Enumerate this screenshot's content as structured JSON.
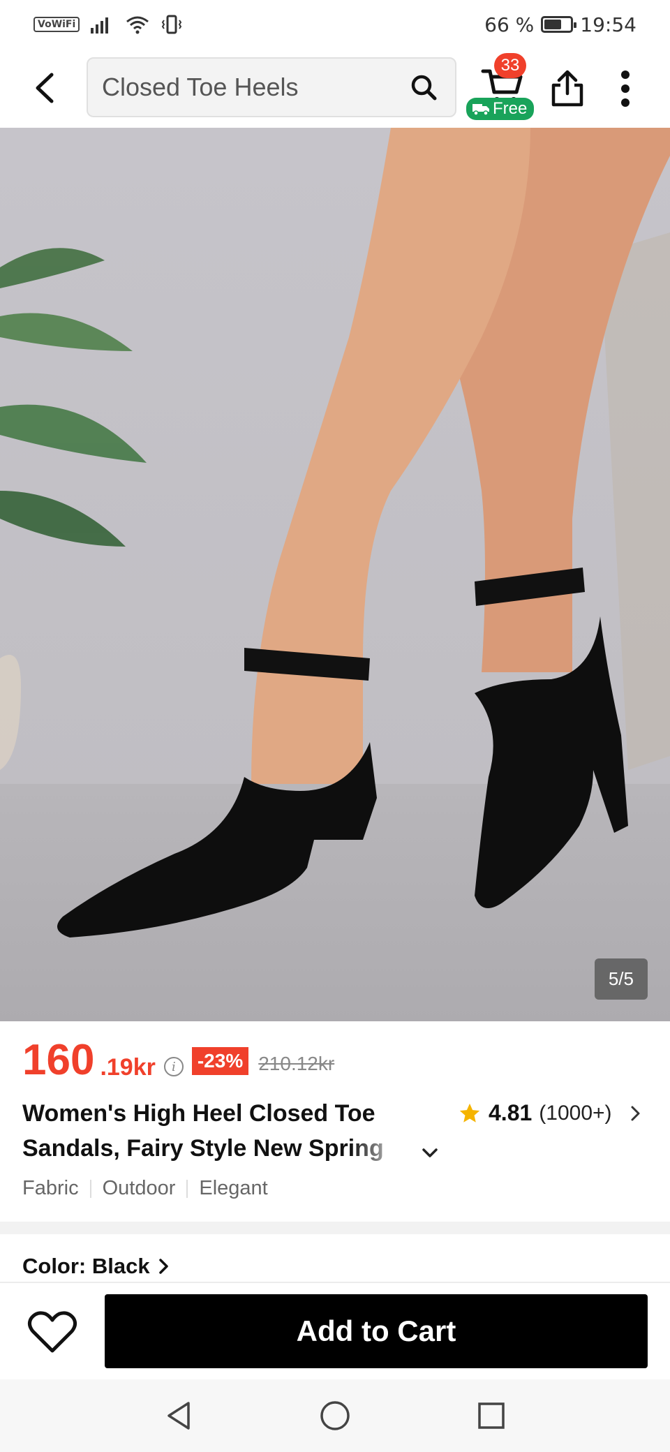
{
  "status_bar": {
    "network_badge": "VoWiFi",
    "battery": "66 %",
    "battery_level": 0.66,
    "time": "19:54"
  },
  "header": {
    "search_value": "Closed Toe Heels",
    "cart_count": "33",
    "free_shipping_label": "Free"
  },
  "gallery": {
    "counter": "5/5"
  },
  "product": {
    "price_integer": "160",
    "price_decimal": ".19kr",
    "discount": "-23%",
    "original_price": "210.12kr",
    "title_line1": "Women's High Heel Closed Toe",
    "title_line2": "Sandals, Fairy Style New Spring",
    "rating_value": "4.81",
    "rating_count": "(1000+)",
    "tags": [
      "Fabric",
      "Outdoor",
      "Elegant"
    ],
    "color_label": "Color: Black"
  },
  "actions": {
    "add_to_cart": "Add to Cart"
  },
  "colors": {
    "accent": "#f0402b",
    "free_green": "#19a35a",
    "star": "#f5b400",
    "button_bg": "#000000"
  },
  "icons": {
    "back": "back-arrow-icon",
    "search": "search-icon",
    "cart": "cart-icon",
    "truck": "truck-icon",
    "share": "share-icon",
    "more": "more-vertical-icon",
    "info": "info-icon",
    "star": "star-icon",
    "chevron_right": "chevron-right-icon",
    "chevron_down": "chevron-down-icon",
    "heart": "heart-icon",
    "nav_back": "nav-back-icon",
    "nav_home": "nav-home-icon",
    "nav_recents": "nav-recents-icon"
  }
}
